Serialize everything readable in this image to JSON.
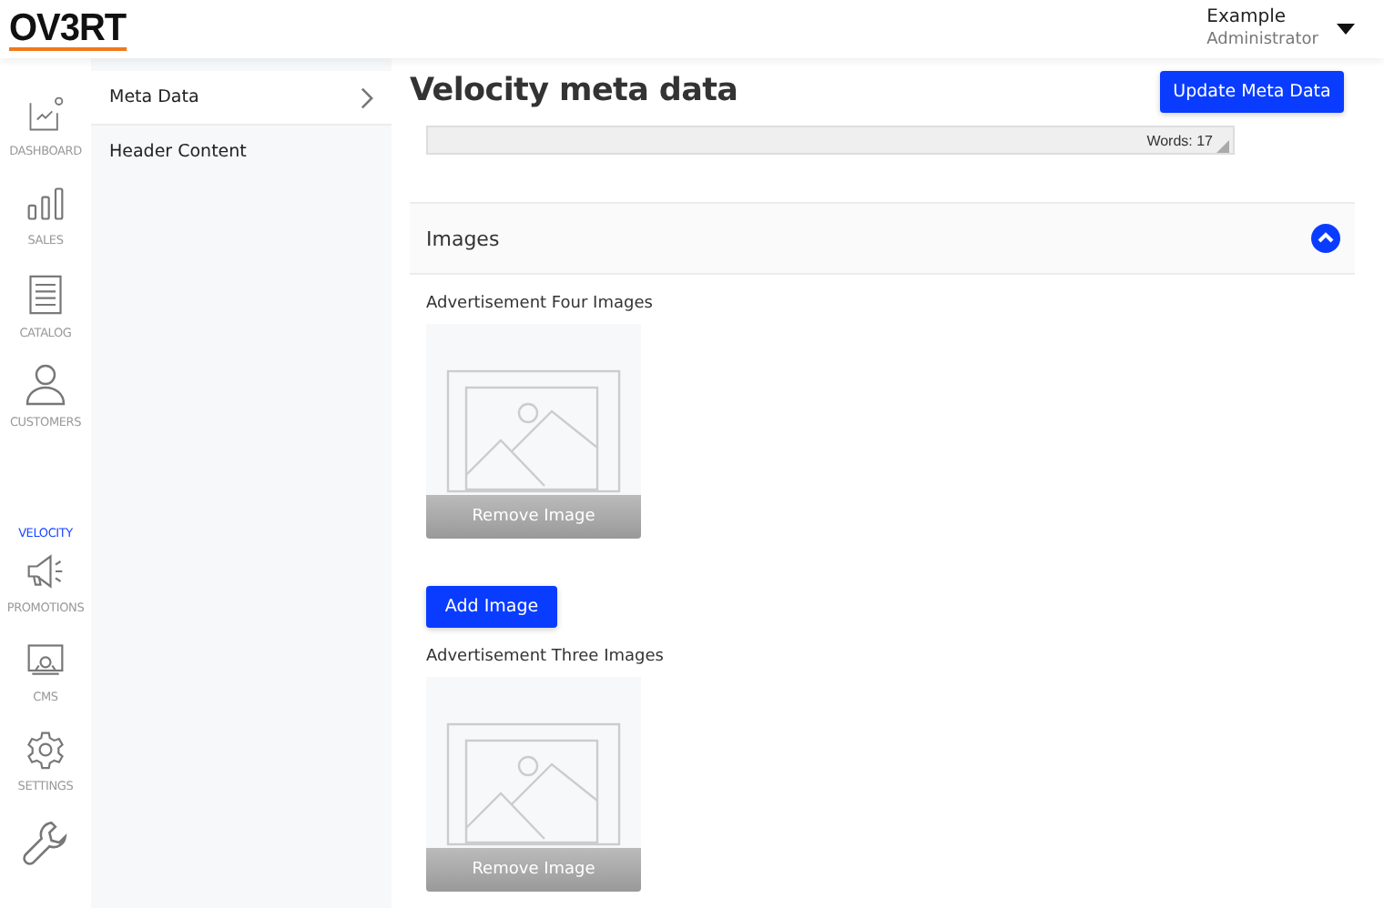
{
  "header": {
    "logo": "OV3RT",
    "user_name": "Example",
    "user_role": "Administrator"
  },
  "nav": [
    {
      "kind": "chart",
      "label": "DASHBOARD",
      "selected": false
    },
    {
      "kind": "bars",
      "label": "SALES",
      "selected": false
    },
    {
      "kind": "list",
      "label": "CATALOG",
      "selected": false
    },
    {
      "kind": "person",
      "label": "CUSTOMERS",
      "selected": false
    },
    {
      "kind": "text",
      "label": "VELOCITY",
      "selected": true
    },
    {
      "kind": "megaphone",
      "label": "PROMOTIONS",
      "selected": false
    },
    {
      "kind": "monitor",
      "label": "CMS",
      "selected": false
    },
    {
      "kind": "gear",
      "label": "SETTINGS",
      "selected": false
    },
    {
      "kind": "wrench",
      "selected": false
    }
  ],
  "submenu": [
    {
      "label": "Meta Data",
      "selected": true
    },
    {
      "label": "Header Content",
      "selected": false
    }
  ],
  "page_title": "Velocity meta data",
  "update_button": "Update Meta Data",
  "editor": {
    "word_count": "Words: 17"
  },
  "section": {
    "title": "Images",
    "expanded": true,
    "groups": [
      {
        "label": "Advertisement Four Images",
        "remove_button": "Remove Image",
        "add_button": "Add Image"
      },
      {
        "label": "Advertisement Three Images",
        "remove_button": "Remove Image"
      }
    ]
  }
}
